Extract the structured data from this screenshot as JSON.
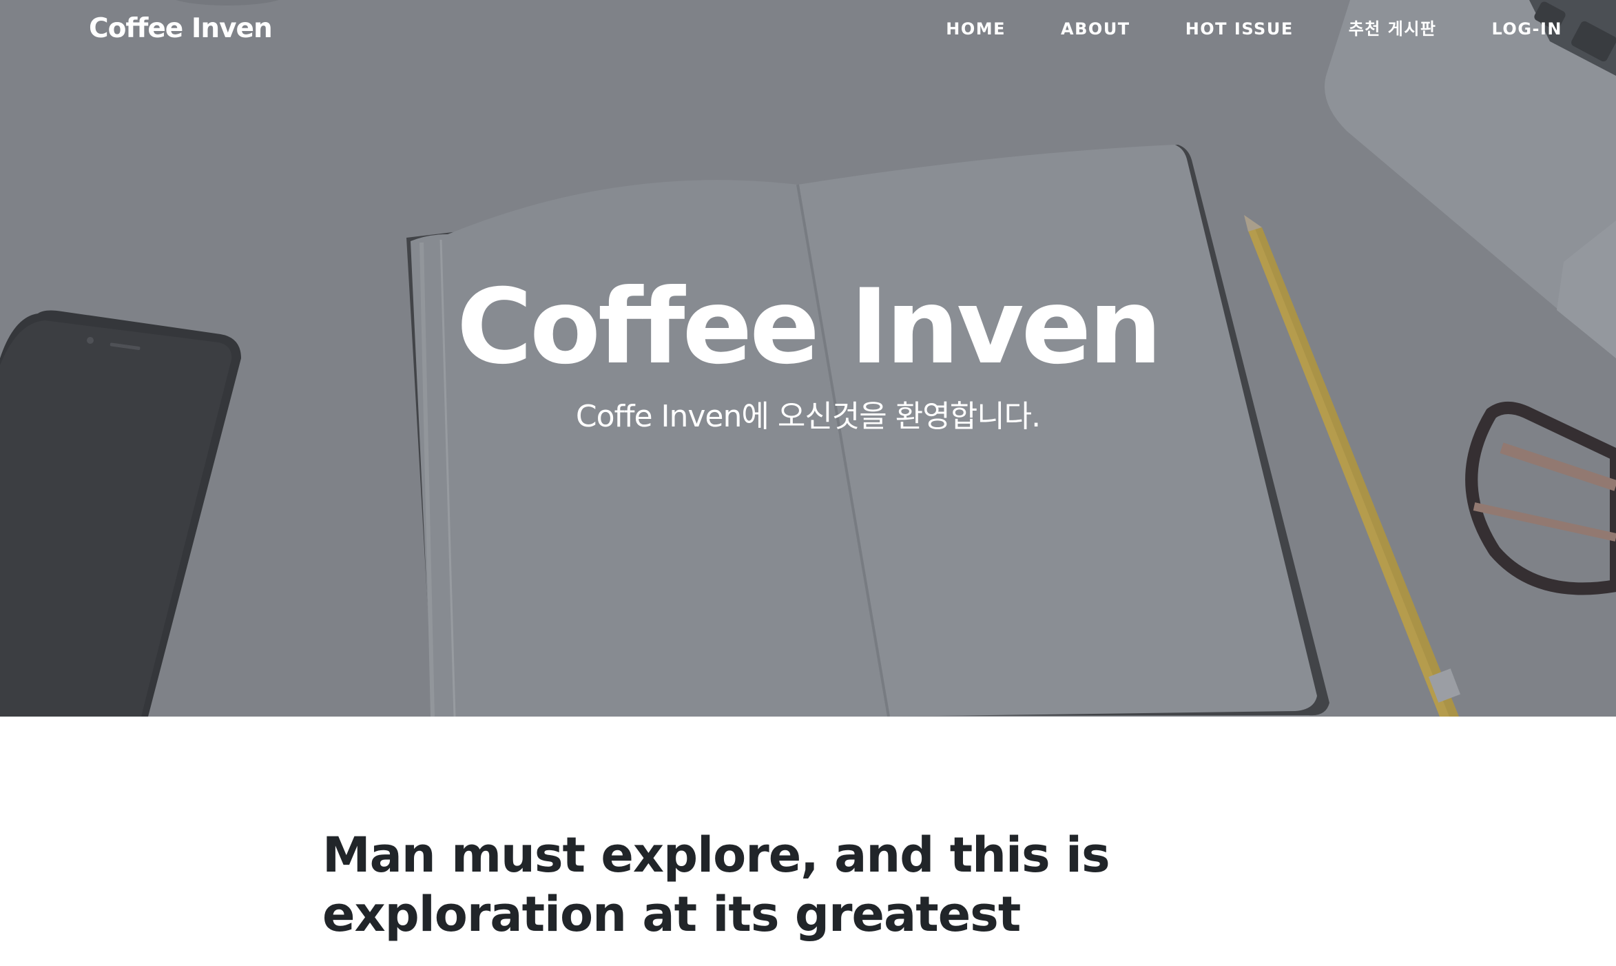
{
  "nav": {
    "brand": "Coffee Inven",
    "items": [
      {
        "label": "HOME"
      },
      {
        "label": "ABOUT"
      },
      {
        "label": "HOT ISSUE"
      },
      {
        "label": "추천 게시판"
      },
      {
        "label": "LOG-IN"
      }
    ]
  },
  "hero": {
    "title": "Coffee Inven",
    "subtitle": "Coffe Inven에 오신것을 환영합니다."
  },
  "post": {
    "title": "Man must explore, and this is exploration at its greatest"
  },
  "colors": {
    "hero_overlay": "#8a8c91",
    "text_dark": "#212529",
    "nav_text": "#ffffff"
  }
}
